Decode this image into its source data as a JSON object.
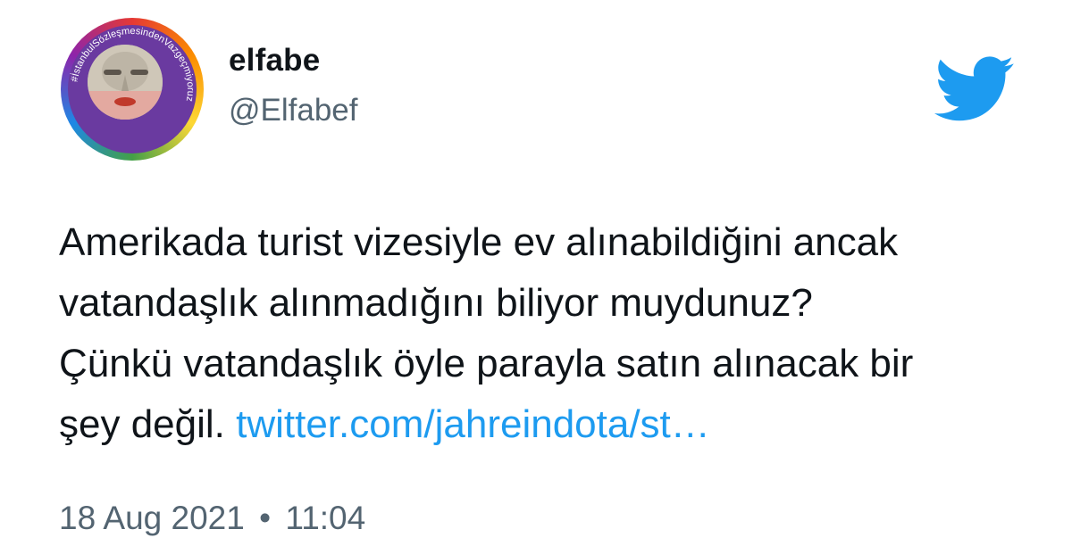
{
  "author": {
    "name": "elfabe",
    "handle": "@Elfabef",
    "avatar_ring_text": "#İstanbulSözleşmesindenVazgeçmiyoruz"
  },
  "tweet": {
    "line1": "Amerikada turist vizesiyle ev alınabildiğini ancak",
    "line2": "vatandaşlık alınmadığını biliyor muydunuz?",
    "line3": "Çünkü vatandaşlık öyle parayla satın alınacak bir",
    "line4_text": "şey değil. ",
    "link": "twitter.com/jahreindota/st…"
  },
  "timestamp": {
    "date": "18 Aug 2021",
    "separator": "•",
    "time": "11:04"
  },
  "icons": {
    "logo": "twitter-bird-icon"
  },
  "colors": {
    "link": "#1d9bf0",
    "secondary_text": "#536471",
    "twitter_blue": "#1d9bf0",
    "avatar_ring": "#6a3aa0"
  }
}
